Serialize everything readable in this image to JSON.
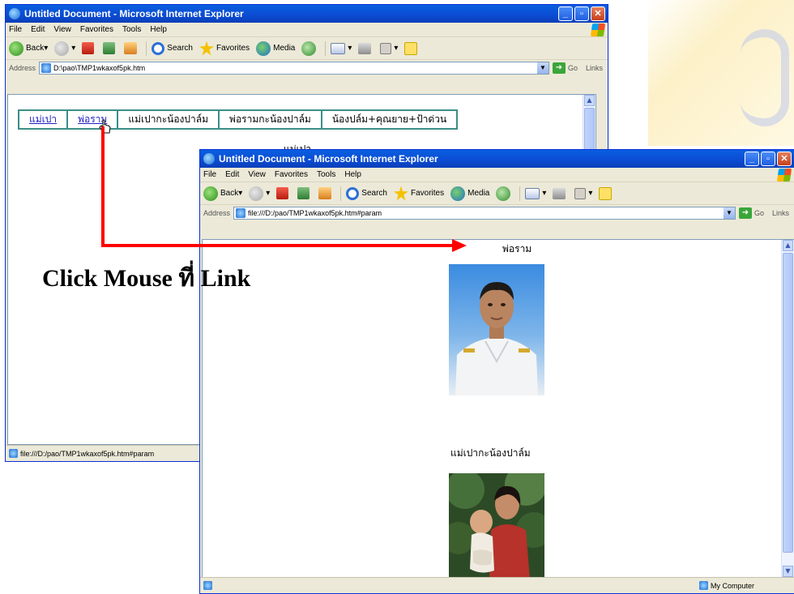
{
  "background_window": {
    "title": "Untitled Document - Microsoft Internet Explorer",
    "menu": [
      "File",
      "Edit",
      "View",
      "Favorites",
      "Tools",
      "Help"
    ],
    "toolbar": {
      "back": "Back",
      "search": "Search",
      "favorites": "Favorites",
      "media": "Media"
    },
    "address": {
      "label": "Address",
      "value": "D:\\pao\\TMP1wkaxof5pk.htm",
      "go": "Go",
      "links": "Links"
    },
    "nav_links": [
      "แม่เปา",
      "พ่อราม",
      "แม่เปากะน้องปาล์ม",
      "พ่อรามกะน้องปาล์ม",
      "น้องปล์ม+คุณยาย+ป้าด่วน"
    ],
    "partial_heading": "แม่เปา",
    "status": "file:///D:/pao/TMP1wkaxof5pk.htm#param"
  },
  "foreground_window": {
    "title": "Untitled Document - Microsoft Internet Explorer",
    "menu": [
      "File",
      "Edit",
      "View",
      "Favorites",
      "Tools",
      "Help"
    ],
    "toolbar": {
      "back": "Back",
      "search": "Search",
      "favorites": "Favorites",
      "media": "Media"
    },
    "address": {
      "label": "Address",
      "value": "file:///D:/pao/TMP1wkaxof5pk.htm#param",
      "go": "Go",
      "links": "Links"
    },
    "section1_title": "พ่อราม",
    "section2_title": "แม่เปากะน้องปาล์ม",
    "status": "My Computer"
  },
  "annotation": {
    "label": "Click Mouse ที่ Link",
    "arrow_color": "#ff0000"
  }
}
